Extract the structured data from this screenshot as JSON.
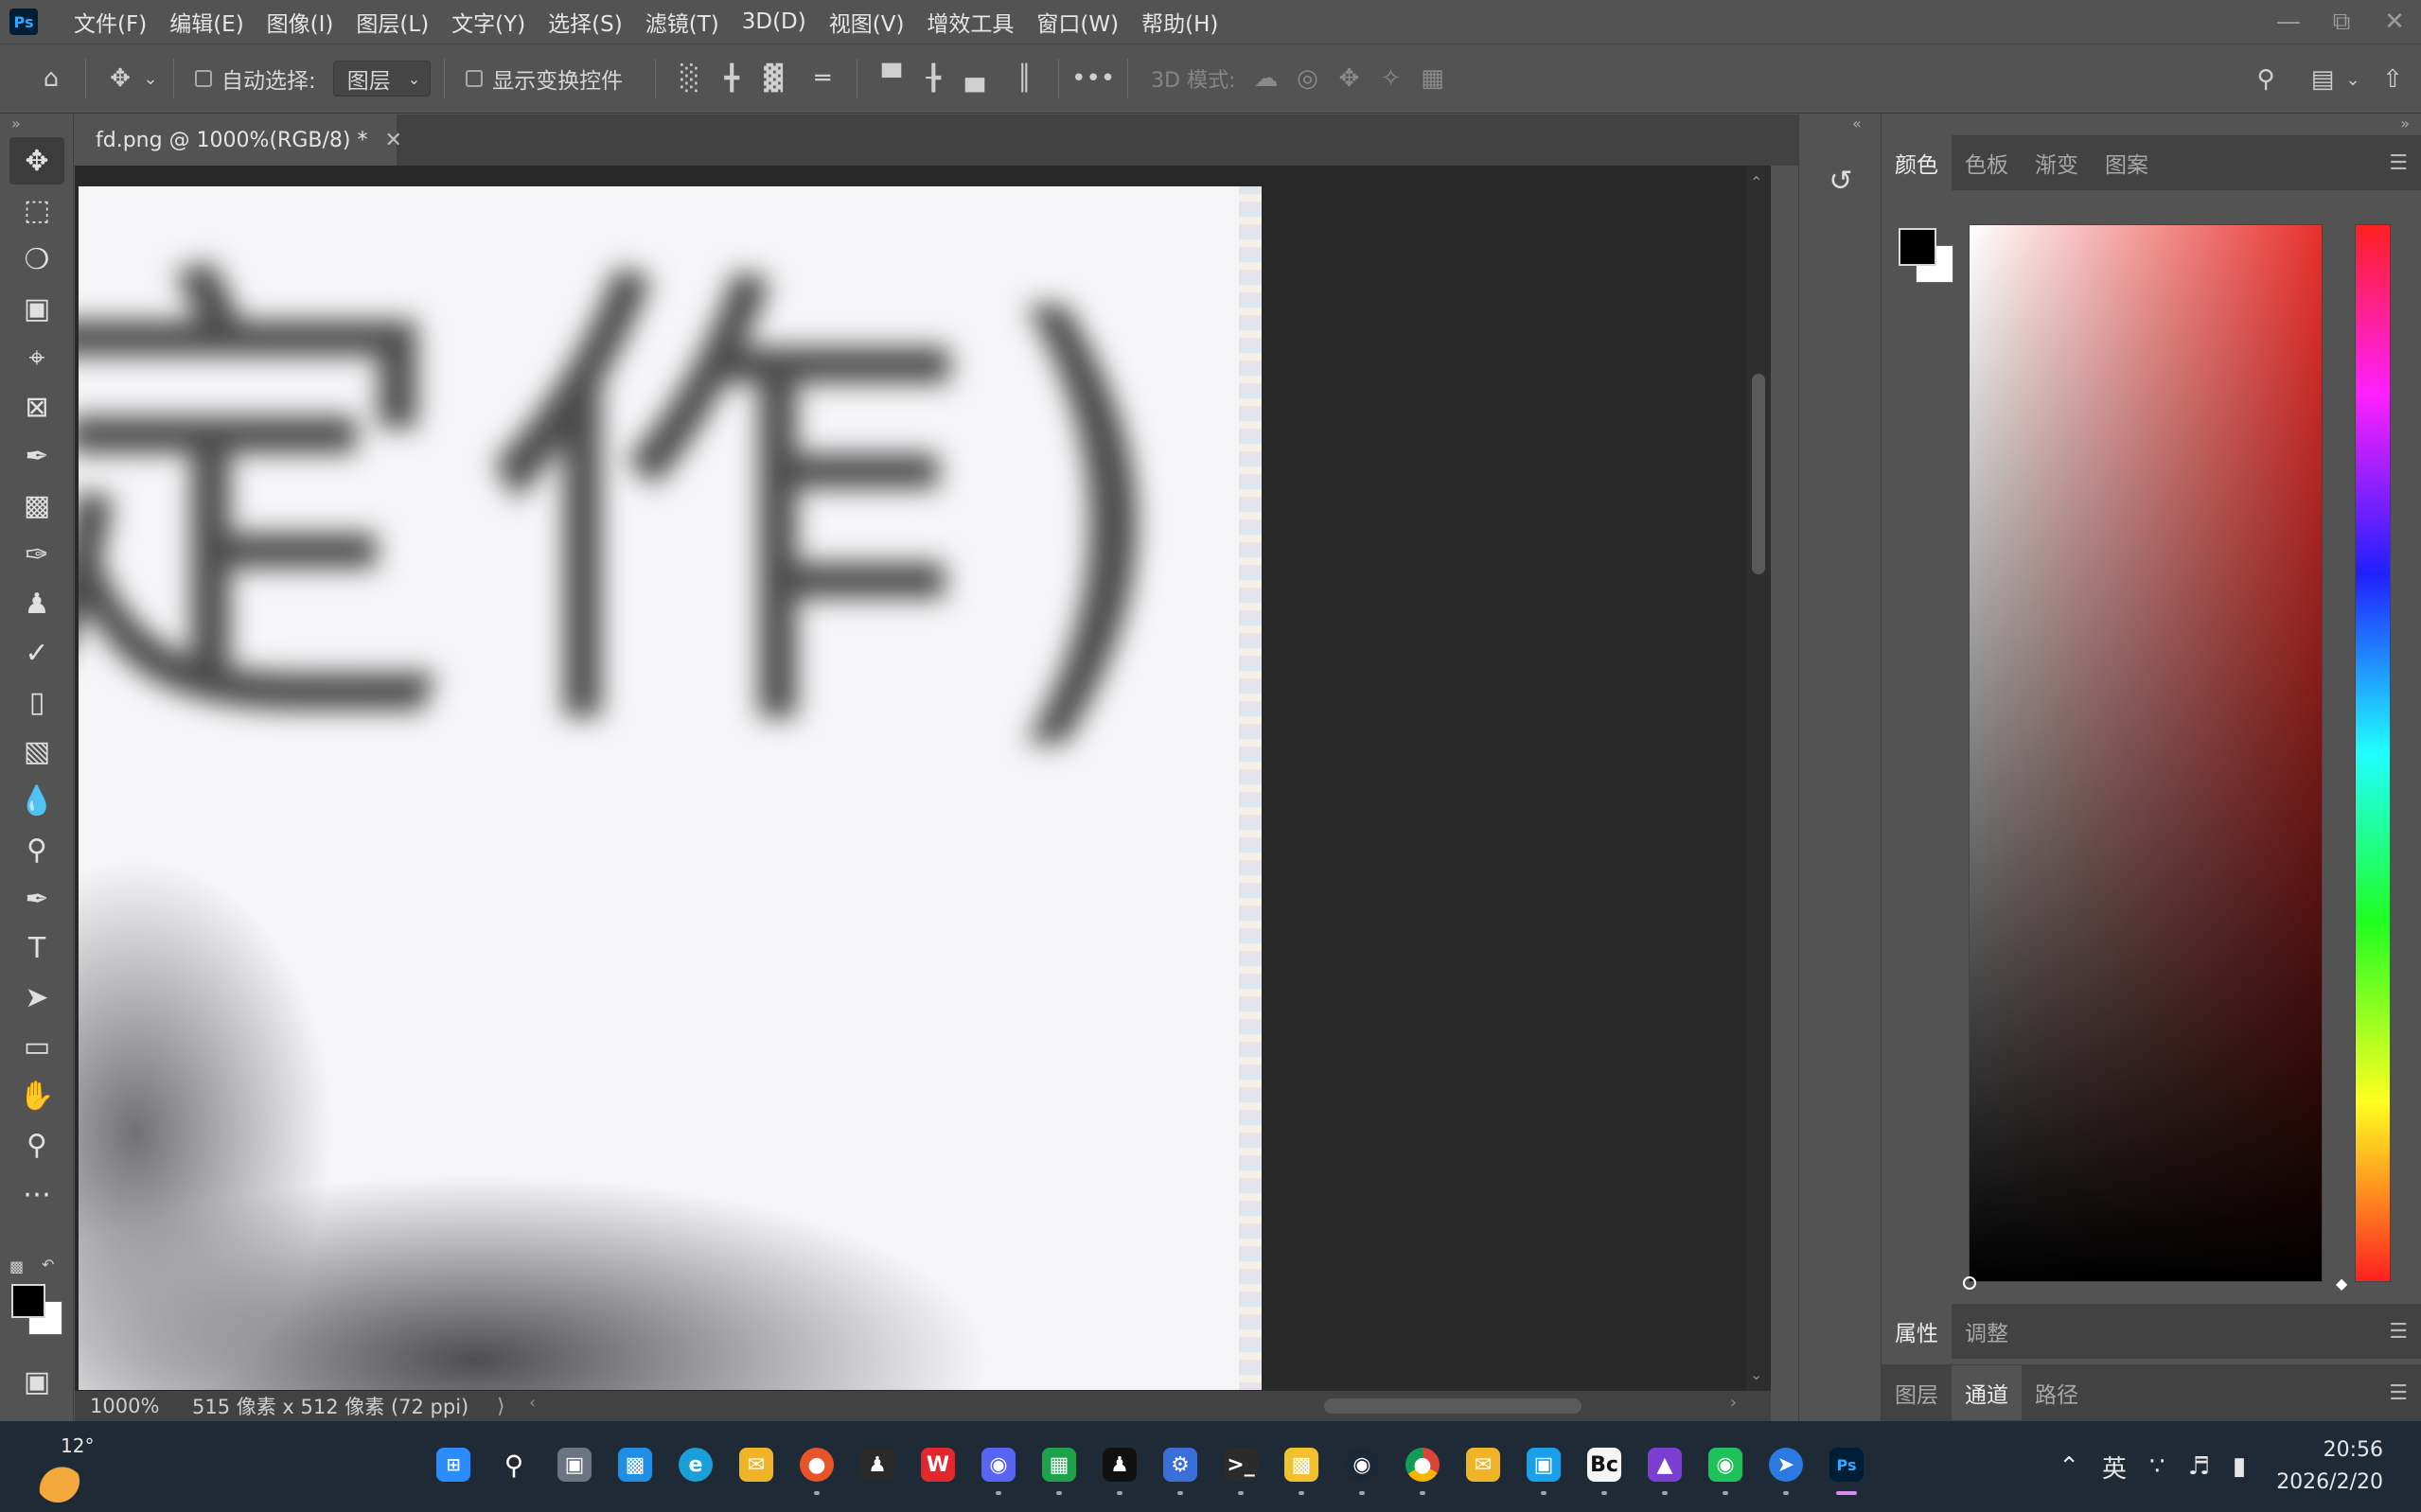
{
  "app": {
    "logo": "Ps"
  },
  "menu": [
    "文件(F)",
    "编辑(E)",
    "图像(I)",
    "图层(L)",
    "文字(Y)",
    "选择(S)",
    "滤镜(T)",
    "3D(D)",
    "视图(V)",
    "增效工具",
    "窗口(W)",
    "帮助(H)"
  ],
  "options": {
    "auto_select_label": "自动选择:",
    "auto_select_target": "图层",
    "show_transform_label": "显示变换控件",
    "more_label": "•••",
    "mode_3d_label": "3D 模式:"
  },
  "document": {
    "tab_title": "fd.png @ 1000%(RGB/8) *",
    "image_text": "定作)"
  },
  "status": {
    "zoom": "1000%",
    "doc_info": "515 像素 x 512 像素 (72 ppi)"
  },
  "panels": {
    "color_tabs": [
      "颜色",
      "色板",
      "渐变",
      "图案"
    ],
    "properties_tabs": [
      "属性",
      "调整"
    ],
    "layers_tabs": [
      "图层",
      "通道",
      "路径"
    ],
    "active_color_tab": "颜色",
    "active_properties_tab": "属性",
    "active_layers_tab": "通道",
    "hue": "#e8302c",
    "foreground": "#000000",
    "background": "#ffffff"
  },
  "taskbar": {
    "temperature": "12°",
    "input_method": "英",
    "time": "20:56",
    "date": "2026/2/20"
  }
}
